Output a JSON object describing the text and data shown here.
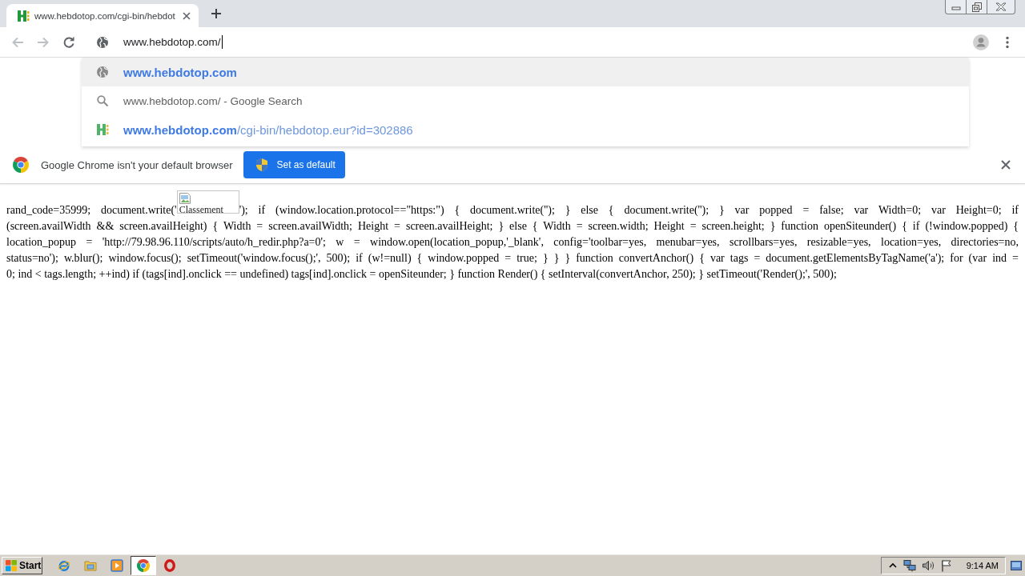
{
  "tabs": [
    {
      "title": "www.hebdotop.com/cgi-bin/hebdot",
      "selected": true
    }
  ],
  "toolbar": {
    "nav": [
      {
        "kind": "back",
        "disabled": true
      },
      {
        "kind": "forward",
        "disabled": true
      },
      {
        "kind": "reload",
        "disabled": false
      }
    ],
    "omnibox": {
      "value": "www.hebdotop.com/",
      "focused": true
    }
  },
  "suggestions": [
    {
      "kind": "url",
      "text": "www.hebdotop.com",
      "selected": true
    },
    {
      "kind": "search",
      "text": "www.hebdotop.com/ - Google Search",
      "selected": false
    },
    {
      "kind": "history",
      "text": "**www.hebdotop.com**/cgi-bin/hebdotop.eur?id=302886",
      "selected": false
    }
  ],
  "infobar": {
    "message": "Google Chrome isn't your default browser",
    "button": "Set as default"
  },
  "page": {
    "lines": [
      {
        "text": "rand_code=35999; document.write('",
        "image_alt": "Classement",
        "after": "'); if (window.location.protocol==\"https:\") { document.write(''); } else { document.write(''); } var popped = false; var Width=0; var Height=0; if"
      },
      {
        "text": "(screen.availWidth && screen.availHeight) { Width = screen.availWidth; Height = screen.availHeight; } else { Width = screen.width; Height = screen.height; } function openSiteunder() { if (!window.popped) {"
      },
      {
        "text": "location_popup = 'http://79.98.96.110/scripts/auto/h_redir.php?a=0'; w = window.open(location_popup,'_blank', config='toolbar=yes, menubar=yes, scrollbars=yes, resizable=yes, location=yes, directories=no,"
      },
      {
        "text": "status=no'); w.blur(); window.focus(); setTimeout('window.focus();', 500); if (w!=null) { window.popped = true; } } } function convertAnchor() { var tags = document.getElementsByTagName('a'); for (var ind ="
      },
      {
        "text": "0; ind < tags.length; ++ind) if (tags[ind].onclick == undefined) tags[ind].onclick = openSiteunder; } function Render() { setInterval(convertAnchor, 250); } setTimeout('Render();', 500);"
      }
    ]
  },
  "taskbar": {
    "start": "Start",
    "apps": [
      {
        "kind": "e_browser",
        "selected": false
      },
      {
        "kind": "folder",
        "selected": false
      },
      {
        "kind": "player",
        "selected": false
      },
      {
        "kind": "wheel_browser",
        "selected": true
      },
      {
        "kind": "o_browser",
        "selected": false
      }
    ],
    "clock": "9:14 AM"
  }
}
